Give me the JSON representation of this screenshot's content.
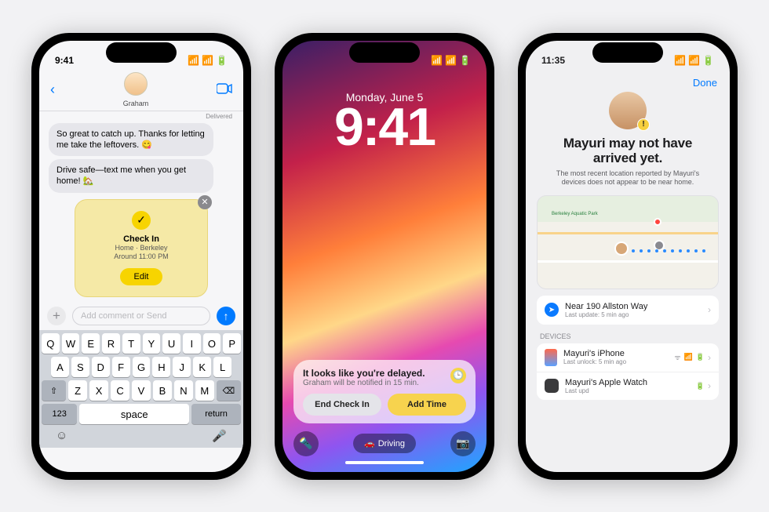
{
  "phone1": {
    "status_time": "9:41",
    "contact_name": "Graham",
    "delivered": "Delivered",
    "messages": [
      "So great to catch up. Thanks for letting me take the leftovers. 😋",
      "Drive safe—text me when you get home! 🏡"
    ],
    "checkin": {
      "title": "Check In",
      "line1": "Home · Berkeley",
      "line2": "Around 11:00 PM",
      "edit": "Edit"
    },
    "compose_placeholder": "Add comment or Send",
    "keys_r1": [
      "Q",
      "W",
      "E",
      "R",
      "T",
      "Y",
      "U",
      "I",
      "O",
      "P"
    ],
    "keys_r2": [
      "A",
      "S",
      "D",
      "F",
      "G",
      "H",
      "J",
      "K",
      "L"
    ],
    "keys_r3": [
      "Z",
      "X",
      "C",
      "V",
      "B",
      "N",
      "M"
    ],
    "key_shift": "⇧",
    "key_del": "⌫",
    "key_123": "123",
    "key_space": "space",
    "key_return": "return"
  },
  "phone2": {
    "status_time": "9:41",
    "date": "Monday, June 5",
    "time": "9:41",
    "notif_title": "It looks like you're delayed.",
    "notif_sub": "Graham will be notified in 15 min.",
    "btn_end": "End Check In",
    "btn_add": "Add Time",
    "driving": "Driving"
  },
  "phone3": {
    "status_time": "11:35",
    "done": "Done",
    "title": "Mayuri may not have arrived yet.",
    "subtitle": "The most recent location reported by Mayuri's devices does not appear to be near home.",
    "park_label": "Berkeley Aquatic Park",
    "loc_title": "Near 190 Allston Way",
    "loc_sub": "Last update: 5 min ago",
    "devices_header": "DEVICES",
    "devices": [
      {
        "name": "Mayuri's iPhone",
        "sub": "Last unlock: 5 min ago"
      },
      {
        "name": "Mayuri's Apple Watch",
        "sub": "Last upd"
      }
    ]
  }
}
